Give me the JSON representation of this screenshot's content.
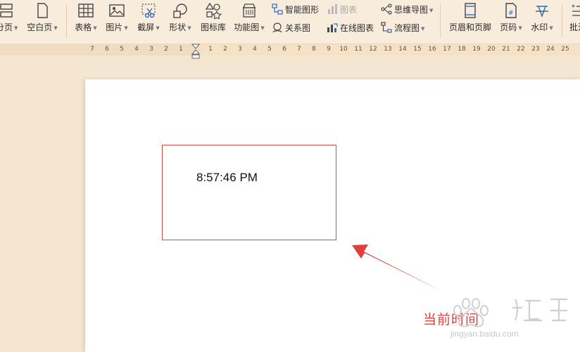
{
  "toolbar": {
    "pagebreak_label": "分页",
    "blank_page_label": "空白页",
    "table_label": "表格",
    "picture_label": "图片",
    "screenshot_label": "截屏",
    "shape_label": "形状",
    "icon_library_label": "图标库",
    "function_chart_label": "功能图",
    "smart_graphic_label": "智能图形",
    "chart_label": "图表",
    "relation_chart_label": "关系图",
    "online_chart_label": "在线图表",
    "mindmap_label": "思维导图",
    "flowchart_label": "流程图",
    "header_footer_label": "页眉和页脚",
    "page_number_label": "页码",
    "watermark_label": "水印",
    "batch_label": "批注"
  },
  "ruler": {
    "numbers": [
      "7",
      "6",
      "5",
      "4",
      "3",
      "2",
      "1",
      "1",
      "2",
      "3",
      "4",
      "5",
      "6",
      "7",
      "8",
      "9",
      "10",
      "11",
      "12",
      "13",
      "14",
      "15",
      "16",
      "17",
      "18",
      "19",
      "20",
      "21",
      "22",
      "23",
      "24",
      "25"
    ]
  },
  "document": {
    "time_value": "8:57:46 PM"
  },
  "annotation": {
    "label": "当前时间",
    "arrow_color": "#e53c3c"
  },
  "watermark": {
    "url": "jingyan.baidu.com"
  },
  "colors": {
    "toolbar_bg": "#f8ecdd",
    "workspace_bg": "#f5e6d2",
    "accent_red": "#e53c3c"
  }
}
